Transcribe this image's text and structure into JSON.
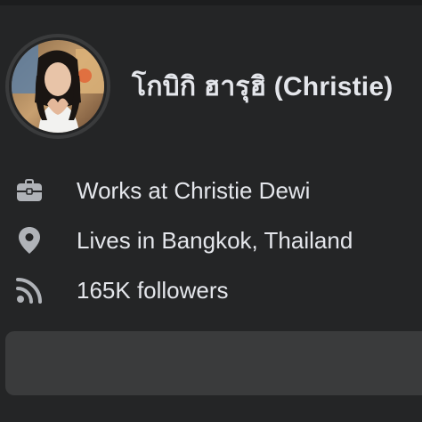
{
  "profile": {
    "name": "โกบิกิ ฮารุฮิ (Christie)",
    "avatar": "profile-photo"
  },
  "details": [
    {
      "icon": "briefcase-icon",
      "text": "Works at Christie Dewi"
    },
    {
      "icon": "location-pin-icon",
      "text": "Lives in Bangkok, Thailand"
    },
    {
      "icon": "rss-feed-icon",
      "text": "165K followers"
    }
  ],
  "action_button": {
    "label": ""
  },
  "colors": {
    "background": "#242526",
    "text": "#e4e6eb",
    "icon": "#b0b3b8",
    "button": "#3a3b3c"
  }
}
